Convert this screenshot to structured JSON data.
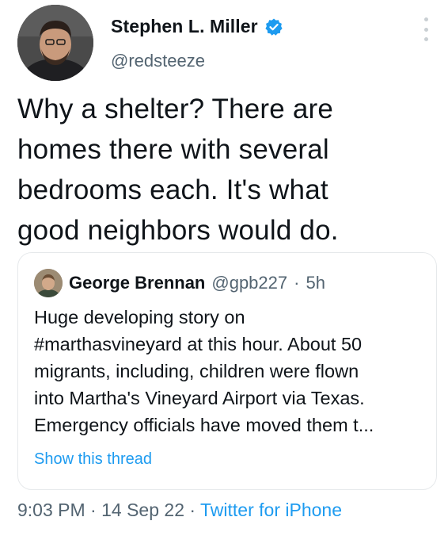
{
  "author": {
    "display_name": "Stephen L. Miller",
    "handle": "@redsteeze",
    "avatar_icon": "user-avatar",
    "verified_icon": "verified-badge-icon",
    "verified_color": "#1d9bf0"
  },
  "menu": {
    "icon": "more-vertical-icon"
  },
  "tweet": {
    "text": "Why a shelter? There are\nhomes there with several\nbedrooms each. It's what\ngood neighbors would do."
  },
  "quoted_tweet": {
    "display_name": "George Brennan",
    "handle": "@gpb227",
    "separator": "·",
    "time": "5h",
    "text": "Huge developing story on\n#marthasvineyard at this hour. About 50\nmigrants, including, children were flown\ninto Martha's Vineyard Airport via Texas.\nEmergency officials have moved them t...",
    "show_thread_label": "Show this thread"
  },
  "meta": {
    "time": "9:03 PM",
    "separator_1": " · ",
    "date": "14 Sep 22",
    "separator_2": " · ",
    "source": "Twitter for iPhone"
  },
  "colors": {
    "link": "#1d9bf0",
    "secondary_text": "#536471",
    "primary_text": "#0f1419"
  }
}
